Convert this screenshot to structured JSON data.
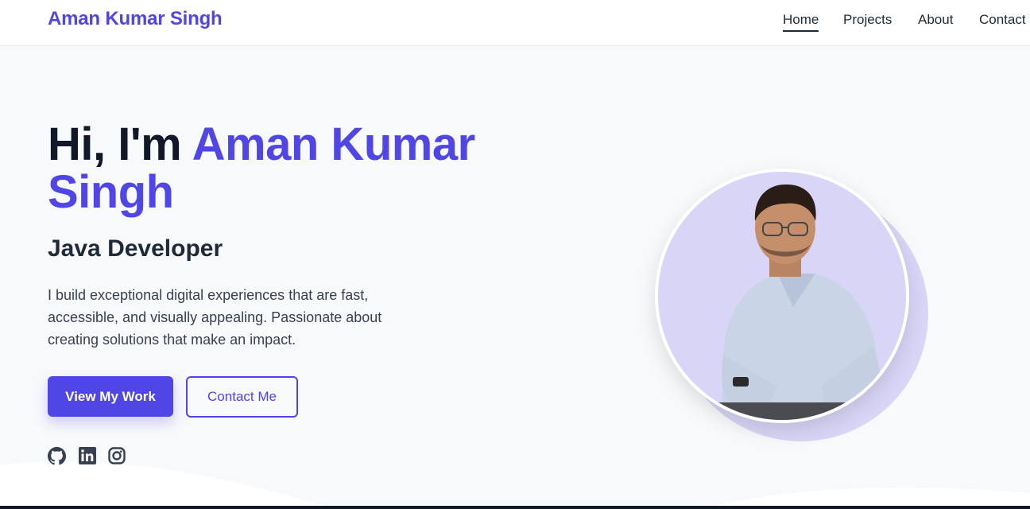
{
  "nav": {
    "brand": "Aman Kumar Singh",
    "links": [
      "Home",
      "Projects",
      "About",
      "Contact"
    ],
    "active": "Home"
  },
  "hero": {
    "greeting": "Hi, I'm ",
    "name_line1": "Aman Kumar",
    "name_line2": "Singh",
    "role": "Java Developer",
    "description": "I build exceptional digital experiences that are fast, accessible, and visually appealing. Passionate about creating solutions that make an impact.",
    "primary_button": "View My Work",
    "secondary_button": "Contact Me"
  },
  "social_icons": [
    "github-icon",
    "linkedin-icon",
    "instagram-icon"
  ],
  "colors": {
    "accent": "#4f46e5",
    "text_dark": "#111827",
    "background": "#f8f9fb",
    "photo_bg": "#d9d5f7"
  }
}
